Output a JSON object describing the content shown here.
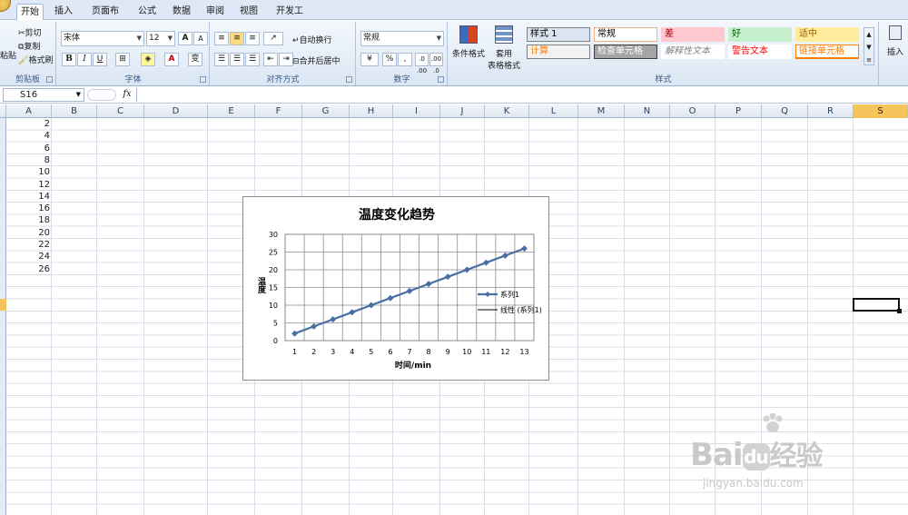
{
  "tabs": [
    "开始",
    "插入",
    "页面布局",
    "公式",
    "数据",
    "审阅",
    "视图",
    "开发工具"
  ],
  "active_tab": "开始",
  "ribbon": {
    "clipboard": {
      "label": "剪贴板",
      "paste": "粘贴",
      "cut": "剪切",
      "copy": "复制",
      "format_painter": "格式刷"
    },
    "font": {
      "label": "字体",
      "font_name": "宋体",
      "font_size": "12",
      "bold": "B",
      "italic": "I",
      "underline": "U",
      "grow": "A",
      "shrink": "A",
      "phonetic": "变"
    },
    "alignment": {
      "label": "对齐方式",
      "wrap_text": "自动换行",
      "merge_center": "合并后居中"
    },
    "number": {
      "label": "数字",
      "format": "常规",
      "percent": "%",
      "comma": ",",
      "inc_decimal": ".0 .00",
      "dec_decimal": ".00 .0"
    },
    "styles": {
      "label": "样式",
      "conditional_format": "条件格式",
      "format_as_table": "套用",
      "format_as_table2": "表格格式",
      "cells": [
        {
          "text": "样式 1",
          "bg": "#dbe5f1",
          "color": "#000000",
          "border": "#7f7f7f"
        },
        {
          "text": "常规",
          "bg": "#ffffff",
          "color": "#000000",
          "border": "#f4b084"
        },
        {
          "text": "差",
          "bg": "#ffc7ce",
          "color": "#9c0006",
          "border": "#ffc7ce"
        },
        {
          "text": "好",
          "bg": "#c6efce",
          "color": "#006100",
          "border": "#c6efce"
        },
        {
          "text": "适中",
          "bg": "#ffeb9c",
          "color": "#9c6500",
          "border": "#ffeb9c"
        },
        {
          "text": "计算",
          "bg": "#f2f2f2",
          "color": "#fa7d00",
          "border": "#7f7f7f"
        },
        {
          "text": "检查单元格",
          "bg": "#a5a5a5",
          "color": "#ffffff",
          "border": "#3f3f3f"
        },
        {
          "text": "解释性文本",
          "bg": "#ffffff",
          "color": "#7f7f7f",
          "border": "#ffffff"
        },
        {
          "text": "警告文本",
          "bg": "#ffffff",
          "color": "#ff0000",
          "border": "#ffffff"
        },
        {
          "text": "链接单元格",
          "bg": "#ffffff",
          "color": "#fa7d00",
          "border": "#ff8001"
        }
      ]
    },
    "cells_group": {
      "insert": "插入"
    }
  },
  "formula_bar": {
    "name_box": "S16",
    "fx": "fx",
    "content": ""
  },
  "columns": [
    "A",
    "B",
    "C",
    "D",
    "E",
    "F",
    "G",
    "H",
    "I",
    "J",
    "K",
    "L",
    "M",
    "N",
    "O",
    "P",
    "Q",
    "R",
    "S"
  ],
  "selected_column": "S",
  "column_a_values": [
    "2",
    "4",
    "6",
    "8",
    "10",
    "12",
    "14",
    "16",
    "18",
    "20",
    "22",
    "24",
    "26"
  ],
  "chart_data": {
    "type": "line",
    "title": "温度变化趋势",
    "xlabel": "时间/min",
    "ylabel": "温度",
    "x": [
      1,
      2,
      3,
      4,
      5,
      6,
      7,
      8,
      9,
      10,
      11,
      12,
      13
    ],
    "series": [
      {
        "name": "系列1",
        "values": [
          2,
          4,
          6,
          8,
          10,
          12,
          14,
          16,
          18,
          20,
          22,
          24,
          26
        ],
        "color": "#4a6fa5",
        "marker": "diamond"
      },
      {
        "name": "线性 (系列1)",
        "values": [
          2,
          4,
          6,
          8,
          10,
          12,
          14,
          16,
          18,
          20,
          22,
          24,
          26
        ],
        "color": "#000000",
        "marker": "none"
      }
    ],
    "ylim": [
      0,
      30
    ],
    "yticks": [
      0,
      5,
      10,
      15,
      20,
      25,
      30
    ],
    "grid": true,
    "legend": "right"
  },
  "watermark": {
    "brand": "Bai",
    "brand2": "经验",
    "url": "jingyan.baidu.com"
  }
}
